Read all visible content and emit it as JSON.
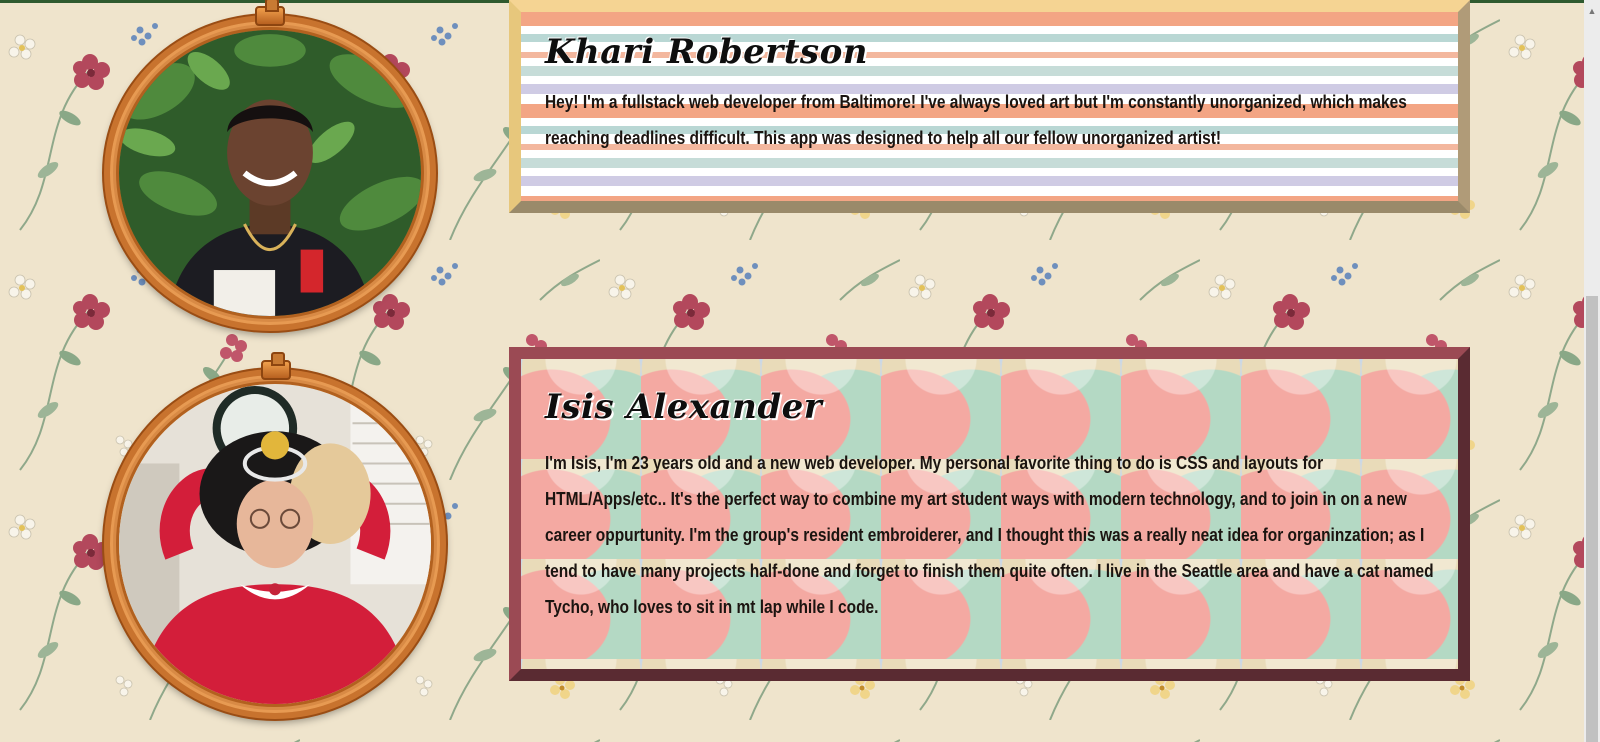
{
  "profiles": [
    {
      "name": "Khari Robertson",
      "bio": "Hey! I'm a fullstack web developer from Baltimore! I've always loved art but I'm constantly unorganized, which makes reaching deadlines difficult. This app was designed to help all our fellow unorganized artist!",
      "photo_icon": "portrait-photo"
    },
    {
      "name": "Isis Alexander",
      "bio": "I'm Isis, I'm 23 years old and a new web developer. My personal favorite thing to do is CSS and layouts for HTML/Apps/etc.. It's the perfect way to combine my art student ways with modern technology, and to join in on a new career oppurtunity. I'm the group's resident embroiderer, and I thought this was a really neat idea for organinzation; as I tend to have many projects half-done and forget to finish them quite often. I live in the Seattle area and have a cat named Tycho, who loves to sit in mt lap while I code.",
      "photo_icon": "portrait-photo"
    }
  ],
  "colors": {
    "wallpaper": "#f0e6cf",
    "hoop_wood": "#c8732e",
    "card_khari_border": "#e7c77c",
    "card_isis_border": "#9b4a54"
  }
}
